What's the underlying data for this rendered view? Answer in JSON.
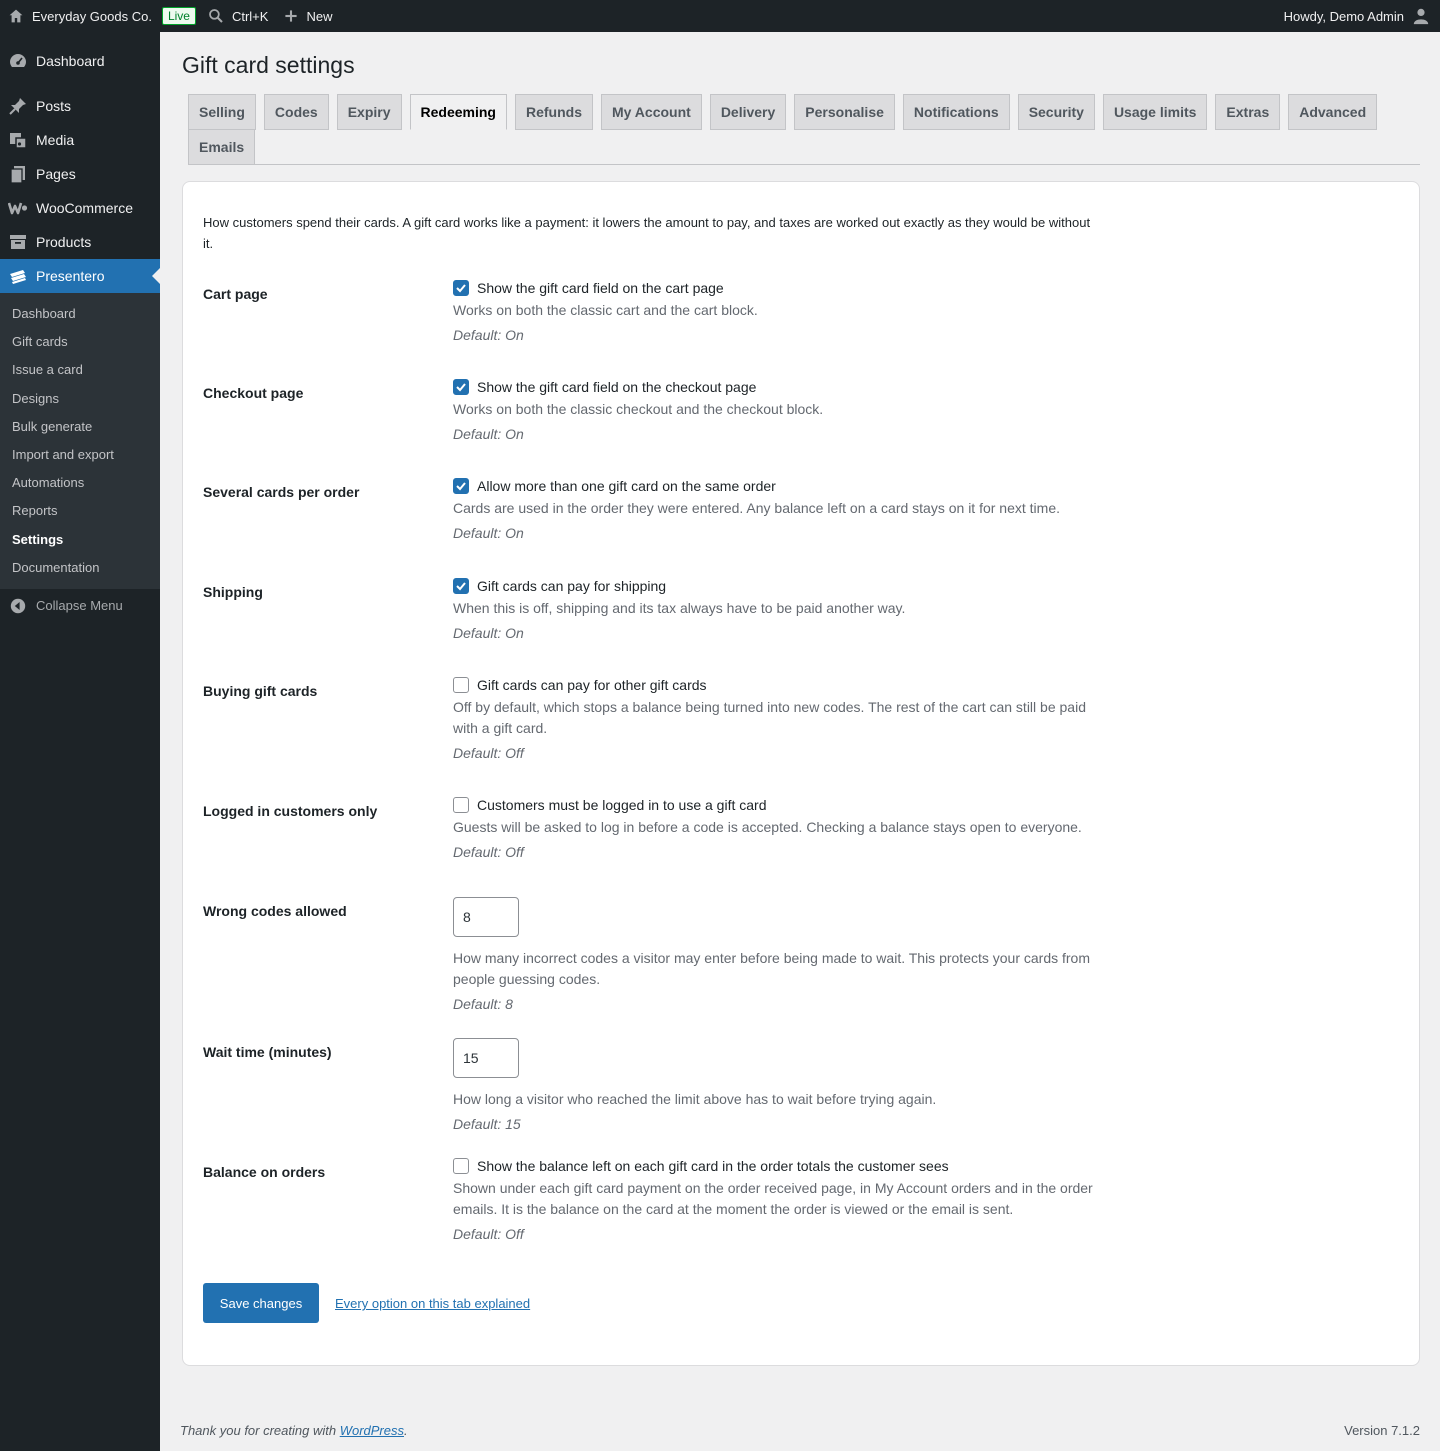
{
  "adminbar": {
    "site_name": "Everyday Goods Co.",
    "live_badge": "Live",
    "search_shortcut": "Ctrl+K",
    "new_label": "New",
    "greeting": "Howdy, Demo Admin"
  },
  "sidebar": {
    "items": [
      {
        "label": "Dashboard",
        "icon": "dashboard-icon"
      },
      {
        "label": "Posts",
        "icon": "pin-icon"
      },
      {
        "label": "Media",
        "icon": "media-icon"
      },
      {
        "label": "Pages",
        "icon": "pages-icon"
      },
      {
        "label": "WooCommerce",
        "icon": "woocommerce-icon"
      },
      {
        "label": "Products",
        "icon": "archive-icon"
      },
      {
        "label": "Presentero",
        "icon": "gift-cards-icon"
      }
    ],
    "submenu": [
      "Dashboard",
      "Gift cards",
      "Issue a card",
      "Designs",
      "Bulk generate",
      "Import and export",
      "Automations",
      "Reports",
      "Settings",
      "Documentation"
    ],
    "collapse_label": "Collapse Menu"
  },
  "page": {
    "title": "Gift card settings",
    "tabs": [
      "Selling",
      "Codes",
      "Expiry",
      "Redeeming",
      "Refunds",
      "My Account",
      "Delivery",
      "Personalise",
      "Notifications",
      "Security",
      "Usage limits",
      "Extras",
      "Advanced",
      "Emails"
    ],
    "active_tab": "Redeeming",
    "intro": "How customers spend their cards. A gift card works like a payment: it lowers the amount to pay, and taxes are worked out exactly as they would be without it."
  },
  "settings": {
    "cart_page": {
      "label": "Cart page",
      "checkbox_label": "Show the gift card field on the cart page",
      "checked": true,
      "description": "Works on both the classic cart and the cart block.",
      "default": "Default: On"
    },
    "checkout_page": {
      "label": "Checkout page",
      "checkbox_label": "Show the gift card field on the checkout page",
      "checked": true,
      "description": "Works on both the classic checkout and the checkout block.",
      "default": "Default: On"
    },
    "several_cards": {
      "label": "Several cards per order",
      "checkbox_label": "Allow more than one gift card on the same order",
      "checked": true,
      "description": "Cards are used in the order they were entered. Any balance left on a card stays on it for next time.",
      "default": "Default: On"
    },
    "shipping": {
      "label": "Shipping",
      "checkbox_label": "Gift cards can pay for shipping",
      "checked": true,
      "description": "When this is off, shipping and its tax always have to be paid another way.",
      "default": "Default: On"
    },
    "buying_gift_cards": {
      "label": "Buying gift cards",
      "checkbox_label": "Gift cards can pay for other gift cards",
      "checked": false,
      "description": "Off by default, which stops a balance being turned into new codes. The rest of the cart can still be paid with a gift card.",
      "default": "Default: Off"
    },
    "logged_in_only": {
      "label": "Logged in customers only",
      "checkbox_label": "Customers must be logged in to use a gift card",
      "checked": false,
      "description": "Guests will be asked to log in before a code is accepted. Checking a balance stays open to everyone.",
      "default": "Default: Off"
    },
    "wrong_codes": {
      "label": "Wrong codes allowed",
      "value": "8",
      "description": "How many incorrect codes a visitor may enter before being made to wait. This protects your cards from people guessing codes.",
      "default": "Default: 8"
    },
    "wait_time": {
      "label": "Wait time (minutes)",
      "value": "15",
      "description": "How long a visitor who reached the limit above has to wait before trying again.",
      "default": "Default: 15"
    },
    "balance_on_orders": {
      "label": "Balance on orders",
      "checkbox_label": "Show the balance left on each gift card in the order totals the customer sees",
      "checked": false,
      "description": "Shown under each gift card payment on the order received page, in My Account orders and in the order emails. It is the balance on the card at the moment the order is viewed or the email is sent.",
      "default": "Default: Off"
    }
  },
  "actions": {
    "save_label": "Save changes",
    "explain_link": "Every option on this tab explained"
  },
  "footer": {
    "thanks_prefix": "Thank you for creating with ",
    "wordpress_link": "WordPress",
    "thanks_suffix": ".",
    "version": "Version 7.1.2"
  },
  "colors": {
    "accent": "#2271b1",
    "admin_dark": "#1d2327",
    "live_green": "#00a32a"
  }
}
